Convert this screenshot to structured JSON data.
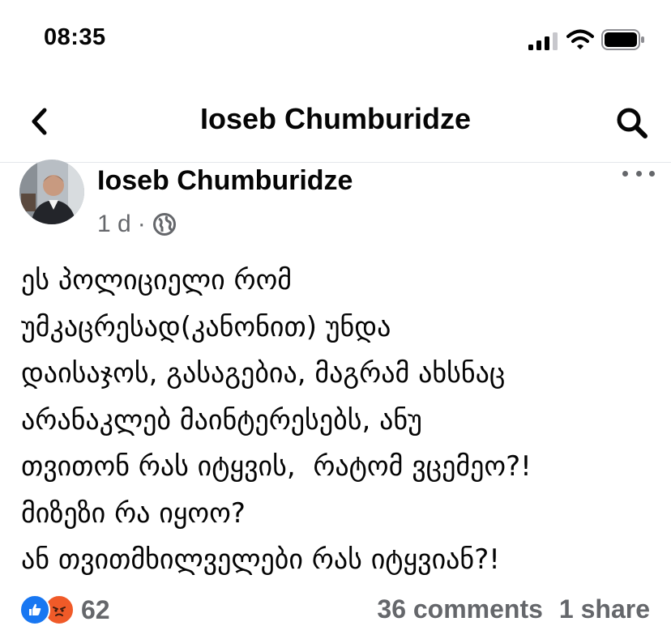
{
  "status_bar": {
    "time": "08:35"
  },
  "nav": {
    "title": "Ioseb Chumburidze"
  },
  "post": {
    "author": "Ioseb Chumburidze",
    "time": "1 d",
    "separator": "·",
    "audience_icon": "globe-icon",
    "lines": [
      "ეს პოლიციელი რომ",
      "უმკაცრესად(კანონით) უნდა",
      "დაისაჯოს, გასაგებია, მაგრამ ახსნაც",
      "არანაკლებ მაინტერესებს, ანუ",
      "თვითონ რას იტყვის,  რატომ ვცემეო?!",
      "მიზეზი რა იყოო?",
      "ან თვითმხილველები რას იტყვიან?!"
    ]
  },
  "reactions": {
    "icons": [
      "like-icon",
      "angry-icon"
    ],
    "count": "62"
  },
  "engagement": {
    "comments": "36 comments",
    "shares": "1 share"
  },
  "colors": {
    "accent": "#1877f2",
    "secondary_text": "#65676b",
    "angry": "#f05a28"
  }
}
